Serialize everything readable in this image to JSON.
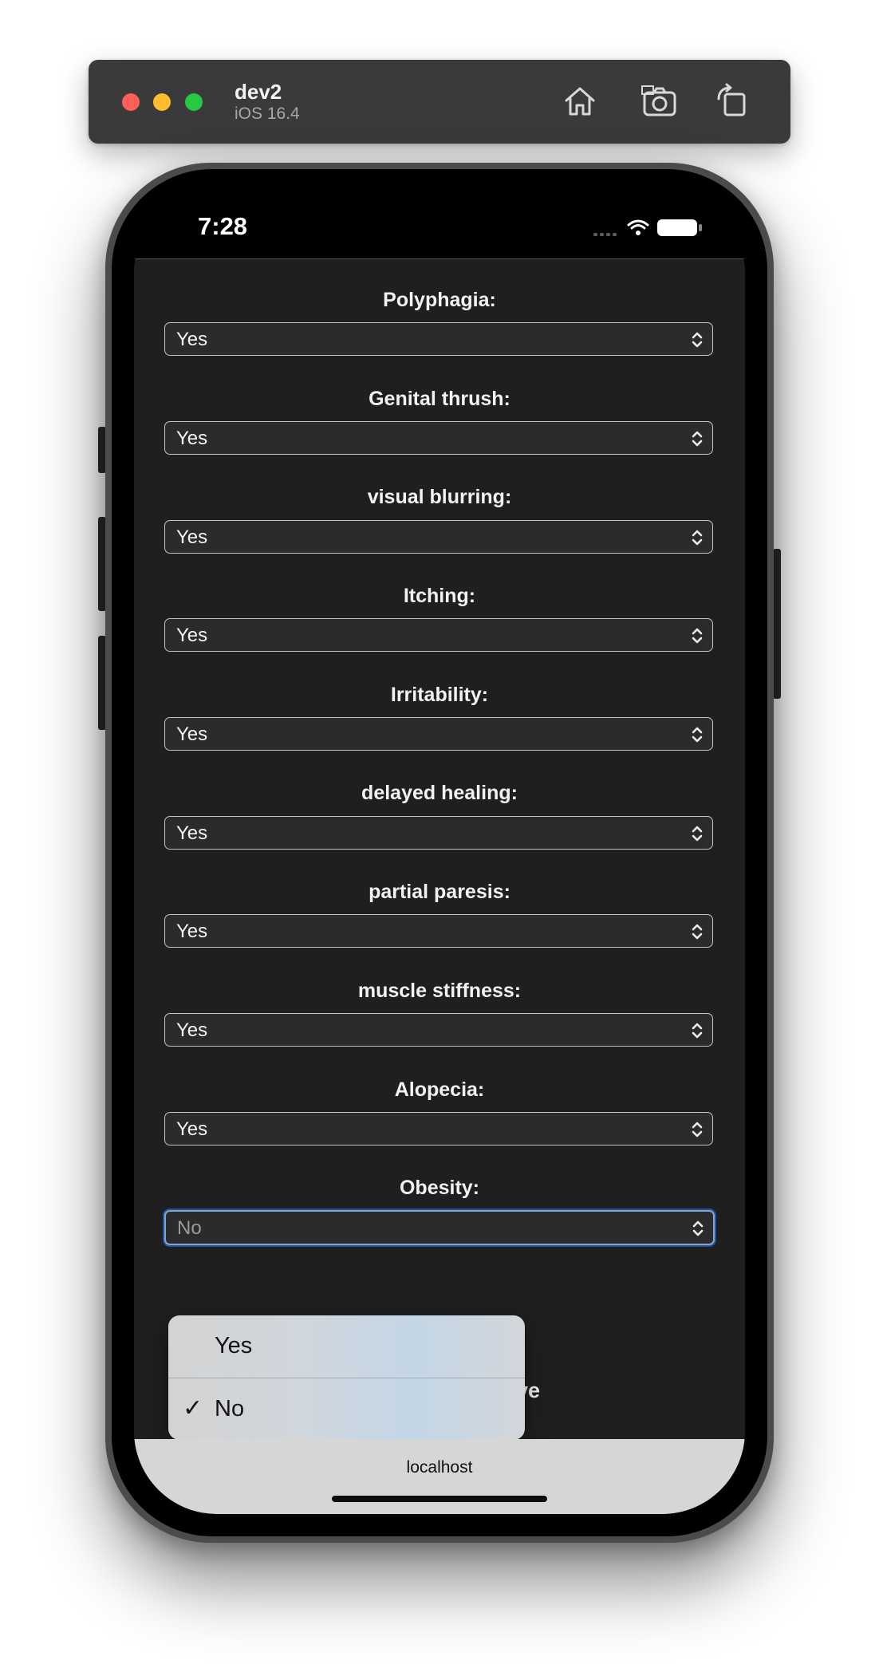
{
  "simulator": {
    "device_name": "dev2",
    "os_version": "iOS 16.4",
    "icons": [
      "home-icon",
      "screenshot-icon",
      "rotate-icon"
    ]
  },
  "status_bar": {
    "time": "7:28"
  },
  "form": {
    "fields": [
      {
        "label": "Polyphagia:",
        "value": "Yes"
      },
      {
        "label": "Genital thrush:",
        "value": "Yes"
      },
      {
        "label": "visual blurring:",
        "value": "Yes"
      },
      {
        "label": "Itching:",
        "value": "Yes"
      },
      {
        "label": "Irritability:",
        "value": "Yes"
      },
      {
        "label": "delayed healing:",
        "value": "Yes"
      },
      {
        "label": "partial paresis:",
        "value": "Yes"
      },
      {
        "label": "muscle stiffness:",
        "value": "Yes"
      },
      {
        "label": "Alopecia:",
        "value": "Yes"
      },
      {
        "label": "Obesity:",
        "value": "No"
      }
    ],
    "prediction": "Prediction: Positive"
  },
  "picker": {
    "options": [
      {
        "label": "Yes",
        "checked": false
      },
      {
        "label": "No",
        "checked": true
      }
    ],
    "check_glyph": "✓"
  },
  "url_bar": {
    "host": "localhost"
  }
}
